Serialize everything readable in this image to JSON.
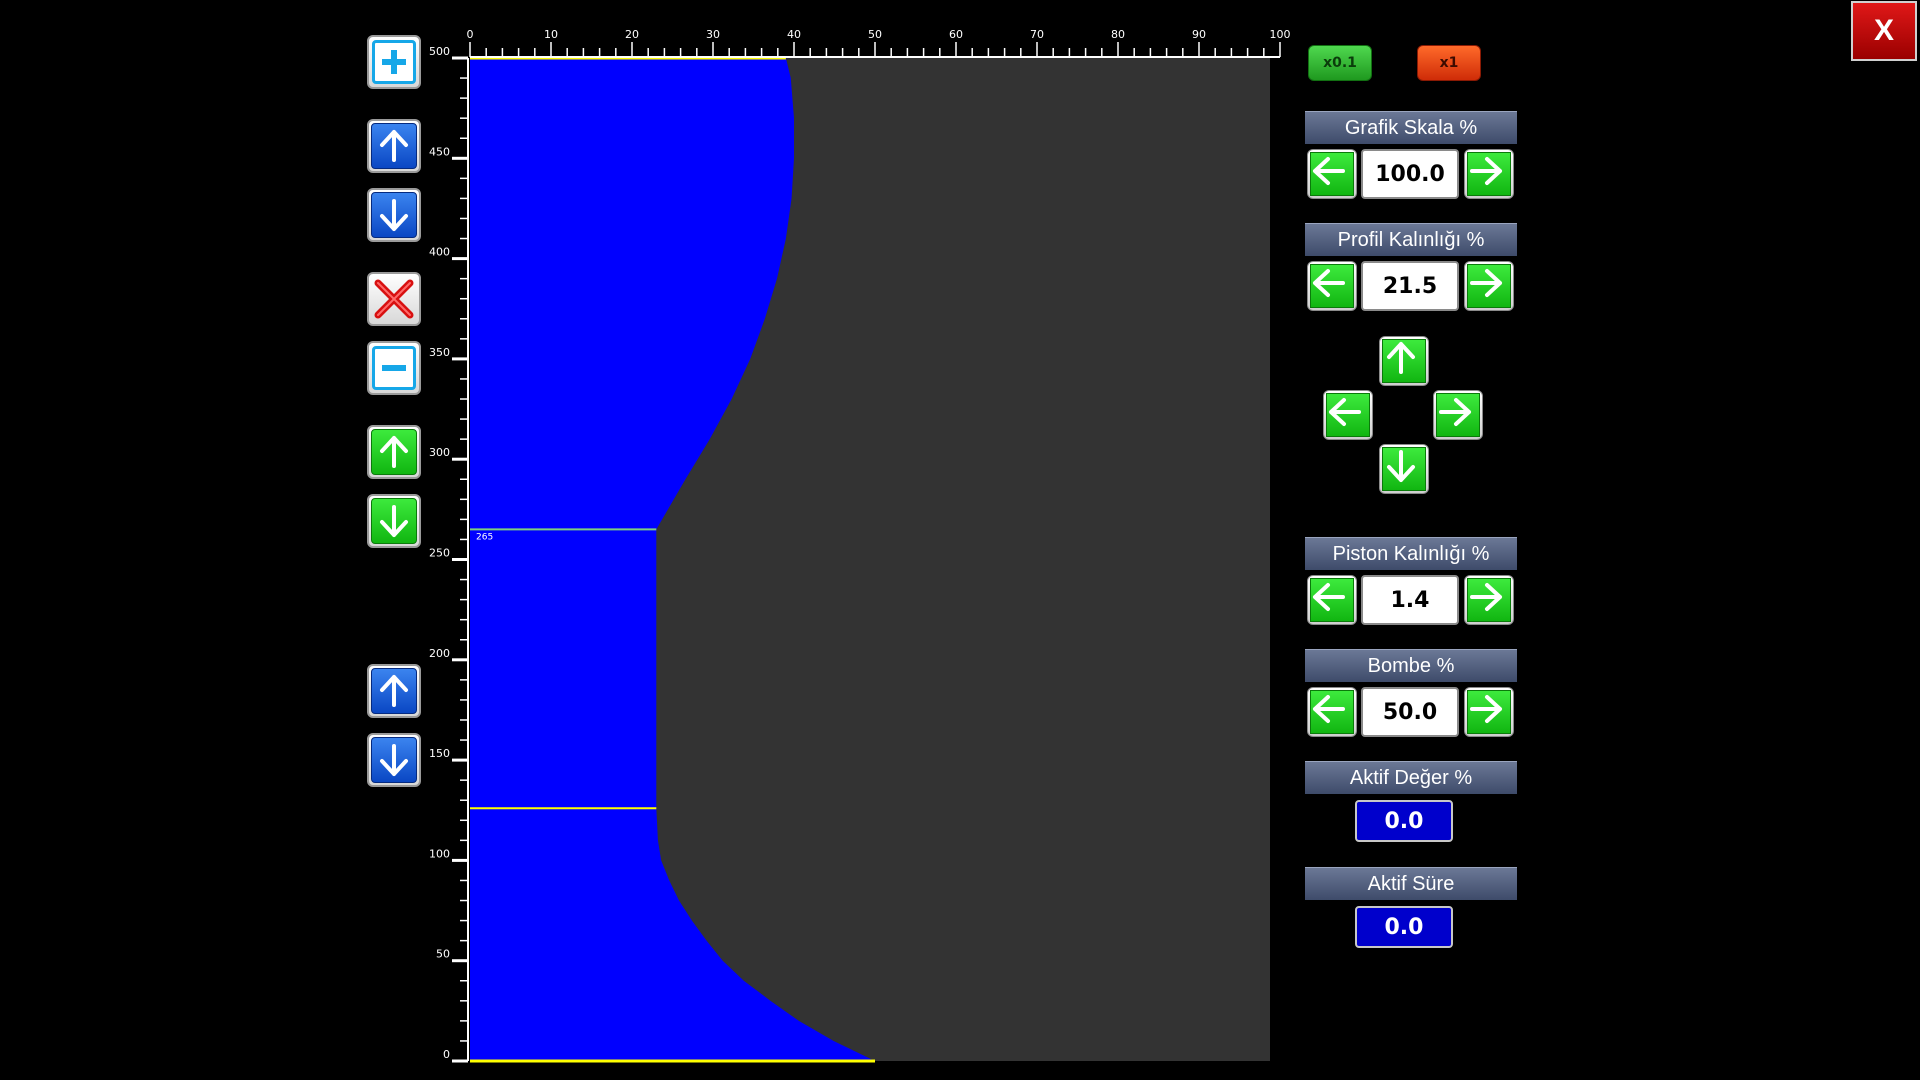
{
  "colors": {
    "profile_fill": "#0000ff",
    "background_area": "#333333",
    "guide_line_yellow": "#ffff00",
    "guide_line_green": "#7fd07f",
    "scale_btn_fine": "#27b027",
    "scale_btn_coarse": "#e03a10",
    "arrow_green": "#1ccf1c",
    "arrow_blue": "#1155dd",
    "active_value_bg": "#0000cc"
  },
  "left_toolbar": {
    "icons": [
      "add-icon",
      "arrow-up-icon",
      "arrow-down-icon",
      "delete-icon",
      "remove-icon",
      "arrow-up-icon",
      "arrow-down-icon",
      "arrow-up-icon",
      "arrow-down-icon"
    ]
  },
  "chart_data": {
    "type": "area",
    "x_ticks": [
      "0",
      "10",
      "20",
      "30",
      "40",
      "50",
      "60",
      "70",
      "80",
      "90",
      "100"
    ],
    "y_ticks": [
      "0",
      "50",
      "100",
      "150",
      "200",
      "250",
      "300",
      "350",
      "400",
      "450",
      "500"
    ],
    "xlim": [
      0,
      100
    ],
    "ylim": [
      0,
      500
    ],
    "marker_label": "265",
    "marker_value": 265,
    "lower_guide_value": 126,
    "piston_x": 23,
    "top_x": 39,
    "bottom_x": 50,
    "profile": [
      [
        0,
        0
      ],
      [
        50,
        0
      ],
      [
        44.9,
        10
      ],
      [
        40.6,
        20
      ],
      [
        37.1,
        30
      ],
      [
        33.8,
        40
      ],
      [
        31.2,
        50
      ],
      [
        29.2,
        60
      ],
      [
        27.4,
        70
      ],
      [
        25.8,
        80
      ],
      [
        24.6,
        90
      ],
      [
        23.6,
        100
      ],
      [
        23.2,
        110
      ],
      [
        23,
        126
      ],
      [
        23,
        265
      ],
      [
        26.6,
        290
      ],
      [
        29.6,
        310
      ],
      [
        32.3,
        330
      ],
      [
        34.6,
        350
      ],
      [
        36.4,
        370
      ],
      [
        37.9,
        390
      ],
      [
        39.0,
        410
      ],
      [
        39.7,
        430
      ],
      [
        40.0,
        450
      ],
      [
        40.0,
        470
      ],
      [
        39.6,
        490
      ],
      [
        39,
        500
      ],
      [
        0,
        500
      ]
    ]
  },
  "speed": {
    "fine": "x0.1",
    "coarse": "x1"
  },
  "grafik_skala": {
    "label": "Grafik Skala %",
    "value": "100.0"
  },
  "profil_kalinligi": {
    "label": "Profil Kalınlığı %",
    "value": "21.5"
  },
  "piston_kalinligi": {
    "label": "Piston Kalınlığı %",
    "value": "1.4"
  },
  "bombe": {
    "label": "Bombe %",
    "value": "50.0"
  },
  "aktif_deger": {
    "label": "Aktif Değer %",
    "value": "0.0"
  },
  "aktif_sure": {
    "label": "Aktif Süre",
    "value": "0.0"
  },
  "close_label": "X"
}
